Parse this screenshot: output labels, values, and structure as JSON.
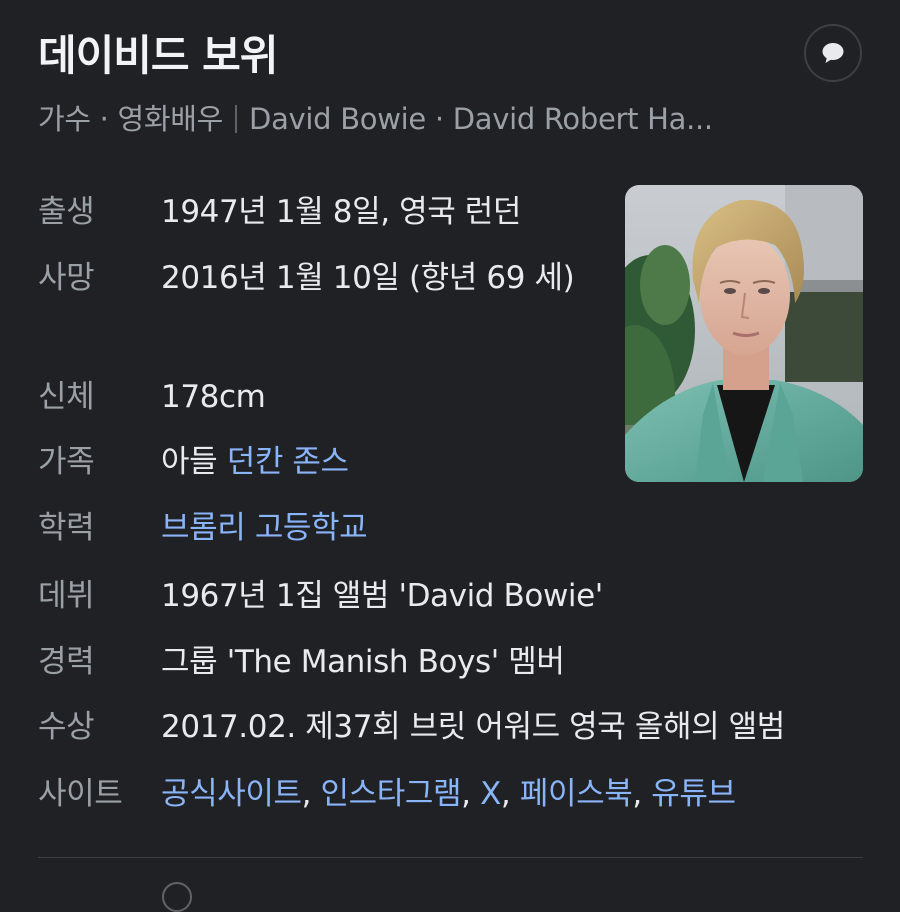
{
  "header": {
    "title": "데이비드 보위",
    "subtitle_roles": "가수 · 영화배우",
    "subtitle_names": "David Bowie · David Robert Ha..."
  },
  "icons": {
    "feedback": "chat-bubble-icon",
    "photo": "portrait-photo"
  },
  "colors": {
    "background": "#202124",
    "label": "#9aa0a6",
    "value": "#e8eaed",
    "link": "#8ab4f8"
  },
  "facts": {
    "born": {
      "label": "출생",
      "value": "1947년 1월 8일, 영국 런던"
    },
    "died": {
      "label": "사망",
      "value": "2016년 1월 10일 (향년 69 세)"
    },
    "height": {
      "label": "신체",
      "value": "178cm"
    },
    "family": {
      "label": "가족",
      "prefix": "아들",
      "link": "던칸 존스"
    },
    "education": {
      "label": "학력",
      "link": "브롬리 고등학교"
    },
    "debut": {
      "label": "데뷔",
      "value": "1967년 1집 앨범 'David Bowie'"
    },
    "career": {
      "label": "경력",
      "value": "그룹 'The Manish Boys' 멤버"
    },
    "awards": {
      "label": "수상",
      "value": "2017.02. 제37회 브릿 어워드 영국 올해의 앨범"
    },
    "sites": {
      "label": "사이트",
      "links": [
        "공식사이트",
        "인스타그램",
        "X",
        "페이스북",
        "유튜브"
      ],
      "separator": ", "
    }
  }
}
